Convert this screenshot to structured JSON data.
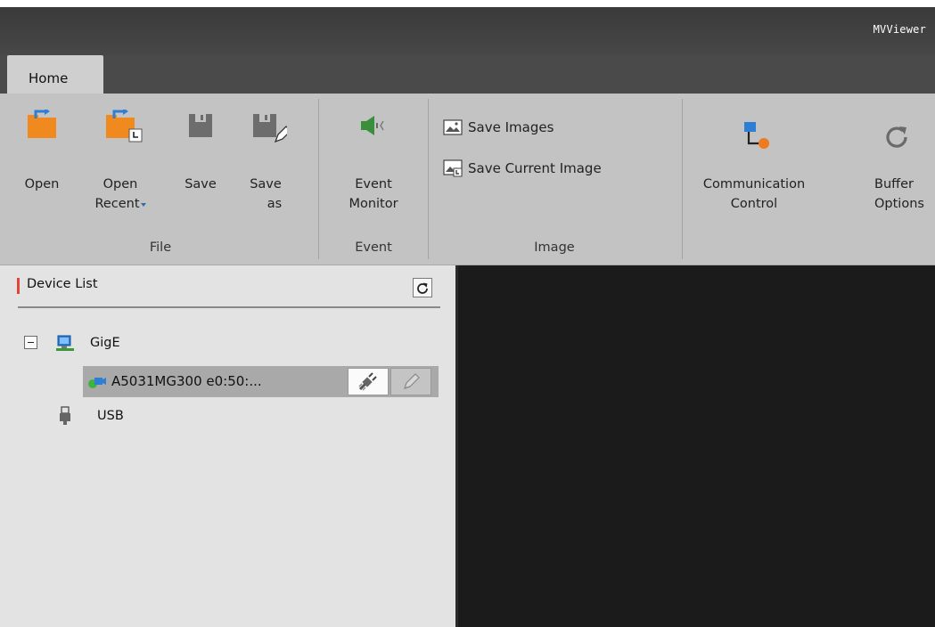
{
  "window": {
    "title": "MVViewer"
  },
  "tabs": [
    {
      "label": "Home",
      "active": true
    }
  ],
  "ribbon": {
    "file": {
      "label": "File",
      "open": {
        "label": "Open",
        "icon": "folder-open-icon"
      },
      "open_recent": {
        "label_line1": "Open",
        "label_line2": "Recent",
        "icon": "folder-recent-icon"
      },
      "save": {
        "label": "Save",
        "icon": "save-icon"
      },
      "save_as": {
        "label_line1": "Save",
        "label_line2": "as",
        "icon": "save-as-icon"
      }
    },
    "event": {
      "label": "Event",
      "event_monitor": {
        "label_line1": "Event",
        "label_line2": "Monitor",
        "icon": "speaker-icon"
      }
    },
    "image": {
      "label": "Image",
      "save_images": {
        "label": "Save Images",
        "icon": "picture-icon"
      },
      "save_current_image": {
        "label": "Save Current Image",
        "icon": "picture-current-icon"
      }
    },
    "communication_control": {
      "label_line1": "Communication",
      "label_line2": "Control",
      "icon": "network-topology-icon"
    },
    "buffer_options": {
      "label_line1": "Buffer",
      "label_line2": "Options",
      "icon": "refresh-arrow-icon"
    }
  },
  "device_panel": {
    "title": "Device List",
    "refresh_icon": "refresh-icon",
    "tree": {
      "gige": {
        "label": "GigE",
        "expanded": true,
        "icon": "network-computer-icon"
      },
      "device": {
        "label": "A5031MG300 e0:50:...",
        "status": "online",
        "icon": "camera-icon"
      },
      "usb": {
        "label": "USB",
        "icon": "usb-plug-icon"
      }
    }
  },
  "colors": {
    "titlebar": "#3f3f3f",
    "ribbon": "#c3c3c3",
    "panel": "#e3e3e3",
    "viewport": "#1b1b1b",
    "accent_orange": "#f08a1e",
    "accent_blue": "#2c7fd4",
    "accent_red": "#e0443c",
    "status_green": "#3fb33f"
  }
}
